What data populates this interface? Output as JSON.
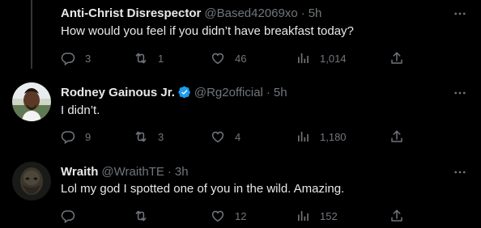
{
  "colors": {
    "background": "#000000",
    "text_primary": "#e7e9ea",
    "text_secondary": "#71767b",
    "verified_badge": "#1d9bf0",
    "thread_line": "#333639"
  },
  "tweets": [
    {
      "display_name": "Anti-Christ Disrespector",
      "handle": "@Based42069xo",
      "separator": "·",
      "time": "5h",
      "verified": false,
      "text": "How would you feel if you didn’t have breakfast today?",
      "replies": "3",
      "retweets": "1",
      "likes": "46",
      "views": "1,014",
      "icons": [
        "reply-icon",
        "retweet-icon",
        "like-icon",
        "views-icon",
        "share-icon",
        "more-icon"
      ]
    },
    {
      "display_name": "Rodney Gainous Jr.",
      "handle": "@Rg2official",
      "separator": "·",
      "time": "5h",
      "verified": true,
      "text": "I didn’t.",
      "replies": "9",
      "retweets": "3",
      "likes": "4",
      "views": "1,180",
      "icons": [
        "reply-icon",
        "retweet-icon",
        "like-icon",
        "views-icon",
        "share-icon",
        "more-icon",
        "verified-badge-icon"
      ]
    },
    {
      "display_name": "Wraith",
      "handle": "@WraithTE",
      "separator": "·",
      "time": "3h",
      "verified": false,
      "text": "Lol my god I spotted one of you in the wild.  Amazing.",
      "replies": "",
      "retweets": "",
      "likes": "12",
      "views": "152",
      "icons": [
        "reply-icon",
        "retweet-icon",
        "like-icon",
        "views-icon",
        "share-icon",
        "more-icon"
      ]
    }
  ]
}
